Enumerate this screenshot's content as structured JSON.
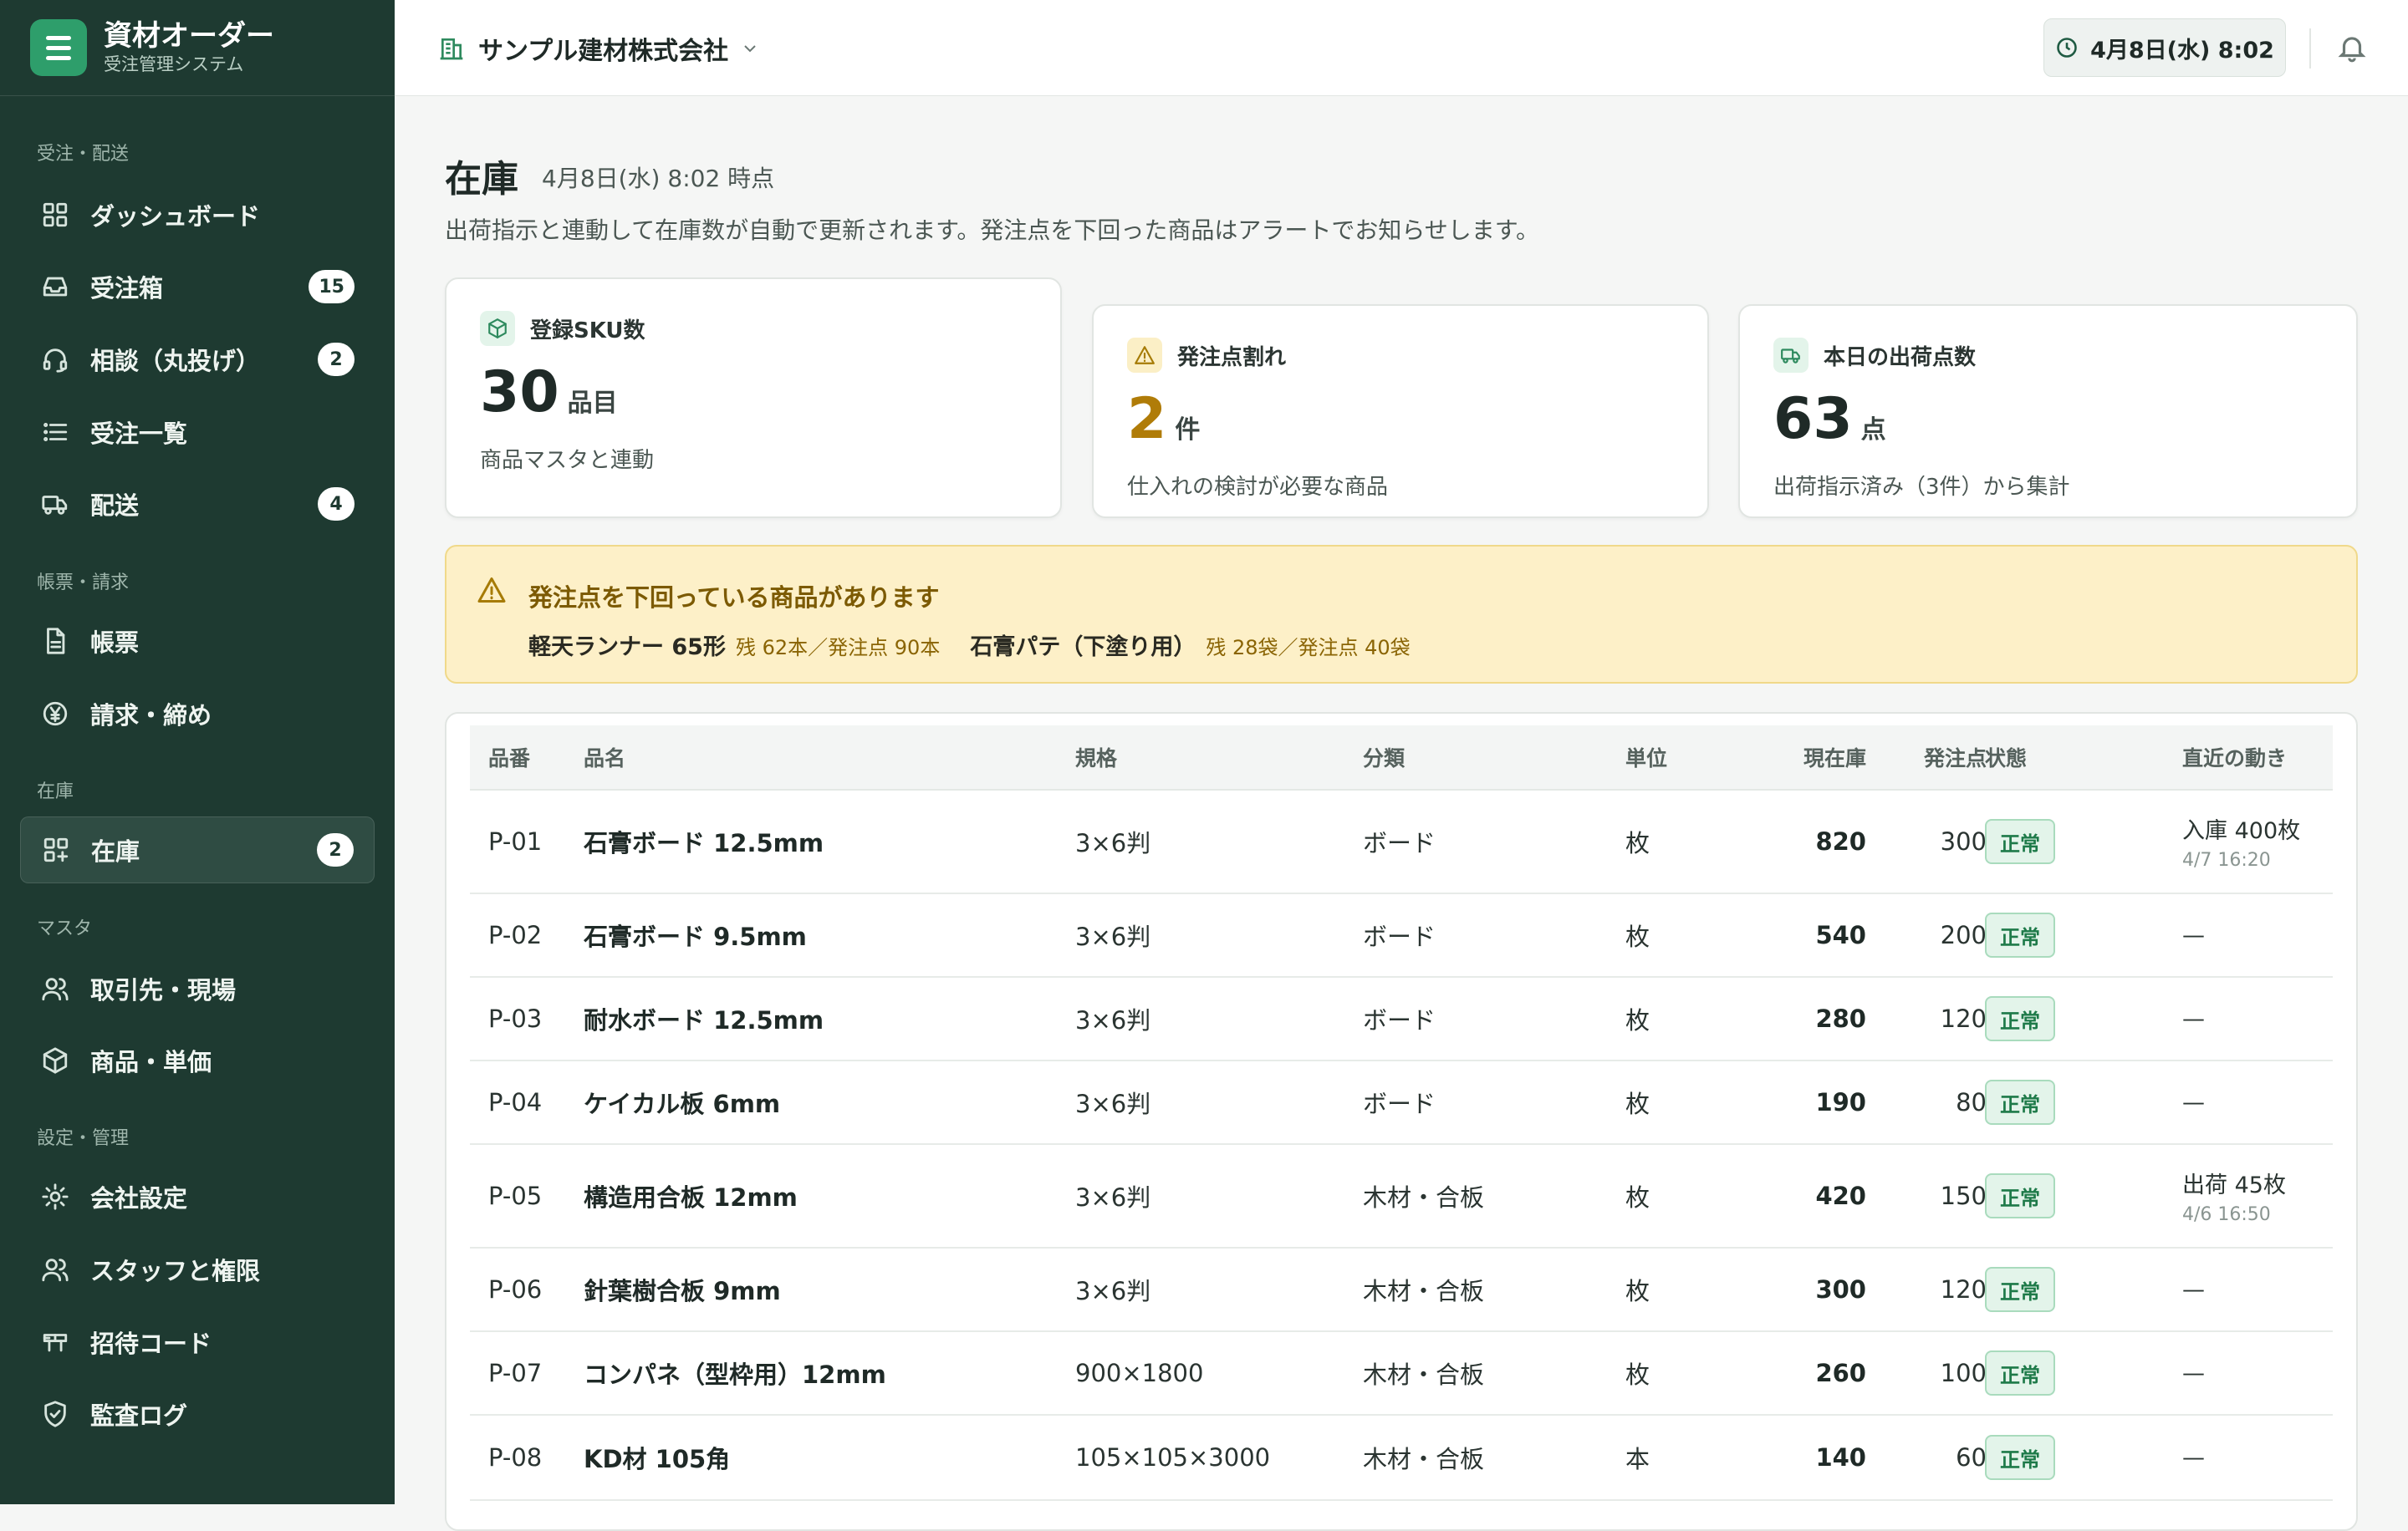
{
  "brand": {
    "title": "資材オーダー",
    "subtitle": "受注管理システム"
  },
  "sidebar": {
    "sections": [
      {
        "label": "受注・配送"
      },
      {
        "label": "帳票・請求"
      },
      {
        "label": "在庫"
      },
      {
        "label": "マスタ"
      },
      {
        "label": "設定・管理"
      }
    ],
    "items": [
      {
        "label": "ダッシュボード",
        "icon": "dashboard-icon"
      },
      {
        "label": "受注箱",
        "icon": "inbox-icon",
        "badge": "15"
      },
      {
        "label": "相談（丸投げ）",
        "icon": "headset-icon",
        "badge": "2"
      },
      {
        "label": "受注一覧",
        "icon": "list-icon"
      },
      {
        "label": "配送",
        "icon": "truck-icon",
        "badge": "4"
      },
      {
        "label": "帳票",
        "icon": "document-icon"
      },
      {
        "label": "請求・締め",
        "icon": "yen-icon"
      },
      {
        "label": "在庫",
        "icon": "inventory-icon",
        "badge": "2",
        "active": true
      },
      {
        "label": "取引先・現場",
        "icon": "users-icon"
      },
      {
        "label": "商品・単価",
        "icon": "box-icon"
      },
      {
        "label": "会社設定",
        "icon": "gear-icon"
      },
      {
        "label": "スタッフと権限",
        "icon": "staff-icon"
      },
      {
        "label": "招待コード",
        "icon": "ticket-icon"
      },
      {
        "label": "監査ログ",
        "icon": "shield-icon"
      }
    ]
  },
  "header": {
    "company": "サンプル建材株式会社",
    "datetime": "4月8日(水) 8:02"
  },
  "page": {
    "title": "在庫",
    "time": "4月8日(水) 8:02 時点",
    "description": "出荷指示と連動して在庫数が自動で更新されます。発注点を下回った商品はアラートでお知らせします。"
  },
  "cards": [
    {
      "label": "登録SKU数",
      "value": "30",
      "unit": "品目",
      "note": "商品マスタと連動",
      "icon": "cube-icon",
      "color": "#1f2a27"
    },
    {
      "label": "発注点割れ",
      "value": "2",
      "unit": "件",
      "note": "仕入れの検討が必要な商品",
      "icon": "warning-icon",
      "color": "#b07c08"
    },
    {
      "label": "本日の出荷点数",
      "value": "63",
      "unit": "点",
      "note": "出荷指示済み（3件）から集計",
      "icon": "truck-icon",
      "color": "#1f2a27"
    }
  ],
  "alert": {
    "title": "発注点を下回っている商品があります",
    "items": [
      {
        "name": "軽天ランナー 65形",
        "detail": "残 62本／発注点 90本"
      },
      {
        "name": "石膏パテ（下塗り用）",
        "detail": "残 28袋／発注点 40袋"
      }
    ]
  },
  "table": {
    "headers": {
      "code": "品番",
      "name": "品名",
      "spec": "規格",
      "category": "分類",
      "unit": "単位",
      "stock": "現在庫",
      "reorder": "発注点",
      "status": "状態",
      "movement": "直近の動き"
    },
    "rows": [
      {
        "code": "P-01",
        "name": "石膏ボード 12.5mm",
        "spec": "3×6判",
        "category": "ボード",
        "unit": "枚",
        "stock": "820",
        "reorder": "300",
        "status": "正常",
        "movement": "入庫 400枚",
        "movement_time": "4/7 16:20"
      },
      {
        "code": "P-02",
        "name": "石膏ボード 9.5mm",
        "spec": "3×6判",
        "category": "ボード",
        "unit": "枚",
        "stock": "540",
        "reorder": "200",
        "status": "正常",
        "movement": "—",
        "movement_time": ""
      },
      {
        "code": "P-03",
        "name": "耐水ボード 12.5mm",
        "spec": "3×6判",
        "category": "ボード",
        "unit": "枚",
        "stock": "280",
        "reorder": "120",
        "status": "正常",
        "movement": "—",
        "movement_time": ""
      },
      {
        "code": "P-04",
        "name": "ケイカル板 6mm",
        "spec": "3×6判",
        "category": "ボード",
        "unit": "枚",
        "stock": "190",
        "reorder": "80",
        "status": "正常",
        "movement": "—",
        "movement_time": ""
      },
      {
        "code": "P-05",
        "name": "構造用合板 12mm",
        "spec": "3×6判",
        "category": "木材・合板",
        "unit": "枚",
        "stock": "420",
        "reorder": "150",
        "status": "正常",
        "movement": "出荷 45枚",
        "movement_time": "4/6 16:50"
      },
      {
        "code": "P-06",
        "name": "針葉樹合板 9mm",
        "spec": "3×6判",
        "category": "木材・合板",
        "unit": "枚",
        "stock": "300",
        "reorder": "120",
        "status": "正常",
        "movement": "—",
        "movement_time": ""
      },
      {
        "code": "P-07",
        "name": "コンパネ（型枠用）12mm",
        "spec": "900×1800",
        "category": "木材・合板",
        "unit": "枚",
        "stock": "260",
        "reorder": "100",
        "status": "正常",
        "movement": "—",
        "movement_time": ""
      },
      {
        "code": "P-08",
        "name": "KD材 105角",
        "spec": "105×105×3000",
        "category": "木材・合板",
        "unit": "本",
        "stock": "140",
        "reorder": "60",
        "status": "正常",
        "movement": "—",
        "movement_time": ""
      }
    ]
  }
}
